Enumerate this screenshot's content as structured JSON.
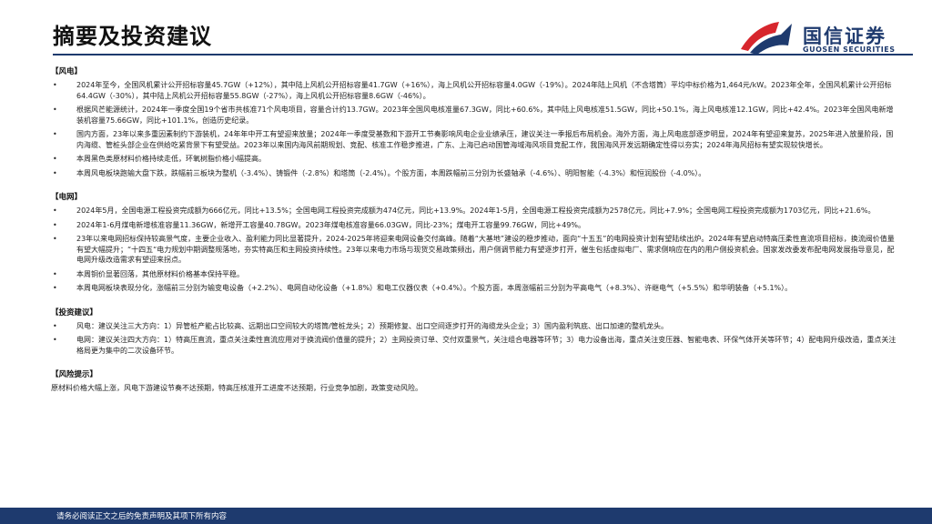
{
  "header": {
    "title": "摘要及投资建议",
    "logo_cn": "国信证券",
    "logo_en": "GUOSEN SECURITIES"
  },
  "colors": {
    "brand_blue": "#1e3a6e",
    "brand_red": "#d7262d"
  },
  "sections": {
    "wind": {
      "title": "【风电】",
      "items": [
        "2024年至今，全国风机累计公开招标容量45.7GW（+12%），其中陆上风机公开招标容量41.7GW（+16%），海上风机公开招标容量4.0GW（-19%）。2024年陆上风机（不含塔筒）平均中标价格为1,464元/kW。2023年全年，全国风机累计公开招标64.4GW（-30%），其中陆上风机公开招标容量55.8GW（-27%），海上风机公开招标容量8.6GW（-46%）。",
        "根据风芒能源统计，2024年一季度全国19个省市共核准71个风电项目，容量合计约13.7GW。2023年全国风电核准量67.3GW，同比+60.6%，其中陆上风电核准51.5GW，同比+50.1%，海上风电核准12.1GW，同比+42.4%。2023年全国风电新增装机容量75.66GW，同比+101.1%，创造历史纪录。",
        "国内方面，23年以来多重因素制约下游装机，24年年中开工有望迎来放量；2024年一季度受基数和下游开工节奏影响风电企业业绩承压，建议关注一季报后布局机会。海外方面，海上风电底部逐步明显，2024年有望迎来复苏，2025年进入放量阶段，国内海缆、管桩头部企业在供给吃紧背景下有望受益。2023年以来国内海风前期规划、竞配、核准工作稳步推进，广东、上海已启动国管海域海风项目竞配工作，我国海风开发远期确定性得以夯实；2024年海风招标有望实现较快增长。",
        "本周黑色类原材料价格持续走低，环氧树脂价格小幅提高。",
        "本周风电板块跑输大盘下跌，跌幅前三板块为整机（-3.4%）、铸锻件（-2.8%）和塔筒（-2.4%）。个股方面，本周跌幅前三分别为长盛轴承（-4.6%）、明阳智能（-4.3%）和恒润股份（-4.0%）。"
      ]
    },
    "grid": {
      "title": "【电网】",
      "items": [
        "2024年5月，全国电源工程投资完成额为666亿元，同比+13.5%；全国电网工程投资完成额为474亿元，同比+13.9%。2024年1-5月，全国电源工程投资完成额为2578亿元，同比+7.9%；全国电网工程投资完成额为1703亿元，同比+21.6%。",
        "2024年1-6月煤电新增核准容量11.36GW，新增开工容量40.78GW。2023年煤电核准容量66.03GW，同比-23%；煤电开工容量99.76GW，同比+49%。",
        "23年以来电网招标保持较高景气度，主要企业收入、盈利能力同比显著提升，2024-2025年将迎来电网设备交付高峰。随着“大基地”建设的稳步推动，面向“十五五”的电网投资计划有望陆续出炉。2024年有望启动特高压柔性直流项目招标，换流阀价值量有望大幅提升；“十四五“电力规划中期调整规落地，夯实特高压和主网投资持续性。23年以来电力市场与现货交易政策频出，用户侧调节能力有望逐步打开，催生包括虚拟电厂、需求侧响应在内的用户侧投资机会。国家发改委发布配电网发展指导意见，配电网升级改造需求有望迎来拐点。",
        "本周铜价显著回落，其他原材料价格基本保持平稳。",
        "本周电网板块表现分化，涨幅前三分别为输变电设备（+2.2%）、电网自动化设备（+1.8%）和电工仪器仪表（+0.4%）。个股方面，本周涨幅前三分别为平高电气（+8.3%）、许继电气（+5.5%）和华明装备（+5.1%）。"
      ]
    },
    "advice": {
      "title": "【投资建议】",
      "items": [
        "风电：建议关注三大方向：1）异管桩产能占比较高、远期出口空间较大的塔筒/管桩龙头；2）预期修复、出口空间逐步打开的海缆龙头企业；3）国内盈利筑底、出口加速的整机龙头。",
        "电网：建议关注四大方向：1）特高压直流，重点关注柔性直流应用对于换流阀价值量的提升；2）主网投资订单、交付双重景气，关注组合电器等环节；3）电力设备出海，重点关注变压器、智能电表、环保气体开关等环节；4）配电网升级改造，重点关注格局更为集中的二次设备环节。"
      ]
    },
    "risk": {
      "title": "【风险提示】",
      "text": "原材料价格大幅上涨，风电下游建设节奏不达预期，特高压核准开工进度不达预期，行业竞争加剧，政策变动风险。"
    }
  },
  "footer": {
    "disclaimer": "请务必阅读正文之后的免责声明及其项下所有内容"
  }
}
